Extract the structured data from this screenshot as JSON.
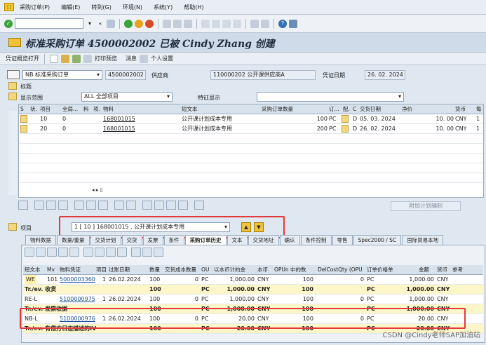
{
  "menu": {
    "items": [
      "采购订单(P)",
      "编辑(E)",
      "转到(G)",
      "环境(N)",
      "系统(Y)",
      "帮助(H)"
    ]
  },
  "title": "标准采购订单 4500002002 已被 Cindy Zhang 创建",
  "appbar": {
    "b1": "凭证概览打开",
    "b2": "打印预览",
    "b3": "消息",
    "b4": "个人设置"
  },
  "header": {
    "doctype": "NB 标准采购订单",
    "po_number": "4500002002",
    "vendor_label": "供应商",
    "vendor": "110000202 公开课供应商A",
    "date_label": "凭证日期",
    "date": "26. 02. 2024"
  },
  "sections": {
    "header_label": "标题",
    "scope_label": "显示范围",
    "scope_value": "ALL 全部项目",
    "special_label": "特征显示"
  },
  "items_grid": {
    "columns": [
      "S",
      "状.",
      "项目",
      "全局...",
      "料",
      "项.",
      "物料",
      "短文本",
      "采购订单数量",
      "订...",
      "配.",
      "C",
      "交货日期",
      "净价",
      "货币",
      "每"
    ],
    "rows": [
      {
        "item": "10",
        "global": "0",
        "material": "168001015",
        "short": "公开课计划成本专用",
        "qty": "100",
        "unit": "PC",
        "cat": "D",
        "date": "05. 03. 2024",
        "price": "10. 00",
        "cur": "CNY",
        "per": "1"
      },
      {
        "item": "20",
        "global": "0",
        "material": "168001015",
        "short": "公开课计划成本专用",
        "qty": "200",
        "unit": "PC",
        "cat": "D",
        "date": "26. 02. 2024",
        "price": "10. 00",
        "cur": "CNY",
        "per": "1"
      }
    ]
  },
  "extra_plan_button": "附加计划编制",
  "item_select": {
    "label": "项目",
    "value": "1 [ 10 ] 168001015 , 公开课计划成本专用"
  },
  "tabs": [
    "物料数据",
    "数量/重量",
    "交货计划",
    "交货",
    "发票",
    "条件",
    "采购订单历史",
    "文本",
    "交货地址",
    "确认",
    "条件控制",
    "零售",
    "Spec2000 / SC",
    "国际贸易本地"
  ],
  "history": {
    "columns": [
      "短文本",
      "Mv",
      "物料凭证",
      "项目",
      "过账日期",
      "数量",
      "交货成本数量",
      "OU",
      "以本币计的金",
      "本币",
      "OPUn 中的数",
      "DelCostQty (OPU",
      "订单价格单",
      "金额",
      "货币",
      "参考"
    ],
    "rows": [
      {
        "type": "row",
        "short": "WE",
        "mv": "101",
        "doc": "5000003360",
        "item": "1",
        "date": "26.02.2024",
        "qty": "100",
        "dcq": "0",
        "ou": "PC",
        "amt": "1,000.00",
        "cur": "CNY",
        "opun": "100",
        "delc": "0",
        "opu": "PC",
        "amount": "1,000.00",
        "cur2": "CNY"
      },
      {
        "type": "sum",
        "short": "Tr./ev. 收货",
        "qty": "100",
        "ou": "PC",
        "amt": "1,000.00",
        "cur": "CNY",
        "opun": "100",
        "opu": "PC",
        "amount": "1,000.00",
        "cur2": "CNY"
      },
      {
        "type": "row",
        "short": "RE-L",
        "mv": "",
        "doc": "5100000975",
        "item": "1",
        "date": "26.02.2024",
        "qty": "100",
        "dcq": "0",
        "ou": "PC",
        "amt": "1,000.00",
        "cur": "CNY",
        "opun": "100",
        "delc": "0",
        "opu": "PC",
        "amount": "1,000.00",
        "cur2": "CNY"
      },
      {
        "type": "sum",
        "short": "Tr./ev. 发票收据",
        "qty": "100",
        "ou": "PC",
        "amt": "1,000.00",
        "cur": "CNY",
        "opun": "100",
        "opu": "PC",
        "amount": "1,000.00",
        "cur2": "CNY"
      },
      {
        "type": "row",
        "short": "NB-L",
        "mv": "",
        "doc": "5100000976",
        "item": "1",
        "date": "26.02.2024",
        "qty": "100",
        "dcq": "0",
        "ou": "PC",
        "amt": "20.00",
        "cur": "CNY",
        "opun": "100",
        "delc": "0",
        "opu": "PC",
        "amount": "20.00",
        "cur2": "CNY"
      },
      {
        "type": "sum",
        "short": "Tr./ev. 有借方日志描述的IV",
        "qty": "100",
        "ou": "PC",
        "amt": "20.00",
        "cur": "CNY",
        "opun": "100",
        "opu": "PC",
        "amount": "20.00",
        "cur2": "CNY"
      }
    ]
  },
  "watermark": "CSDN @Cindy老师SAP加油站",
  "colors": {
    "highlight": "#e23a3a",
    "sum_row": "#fdf6c9"
  }
}
